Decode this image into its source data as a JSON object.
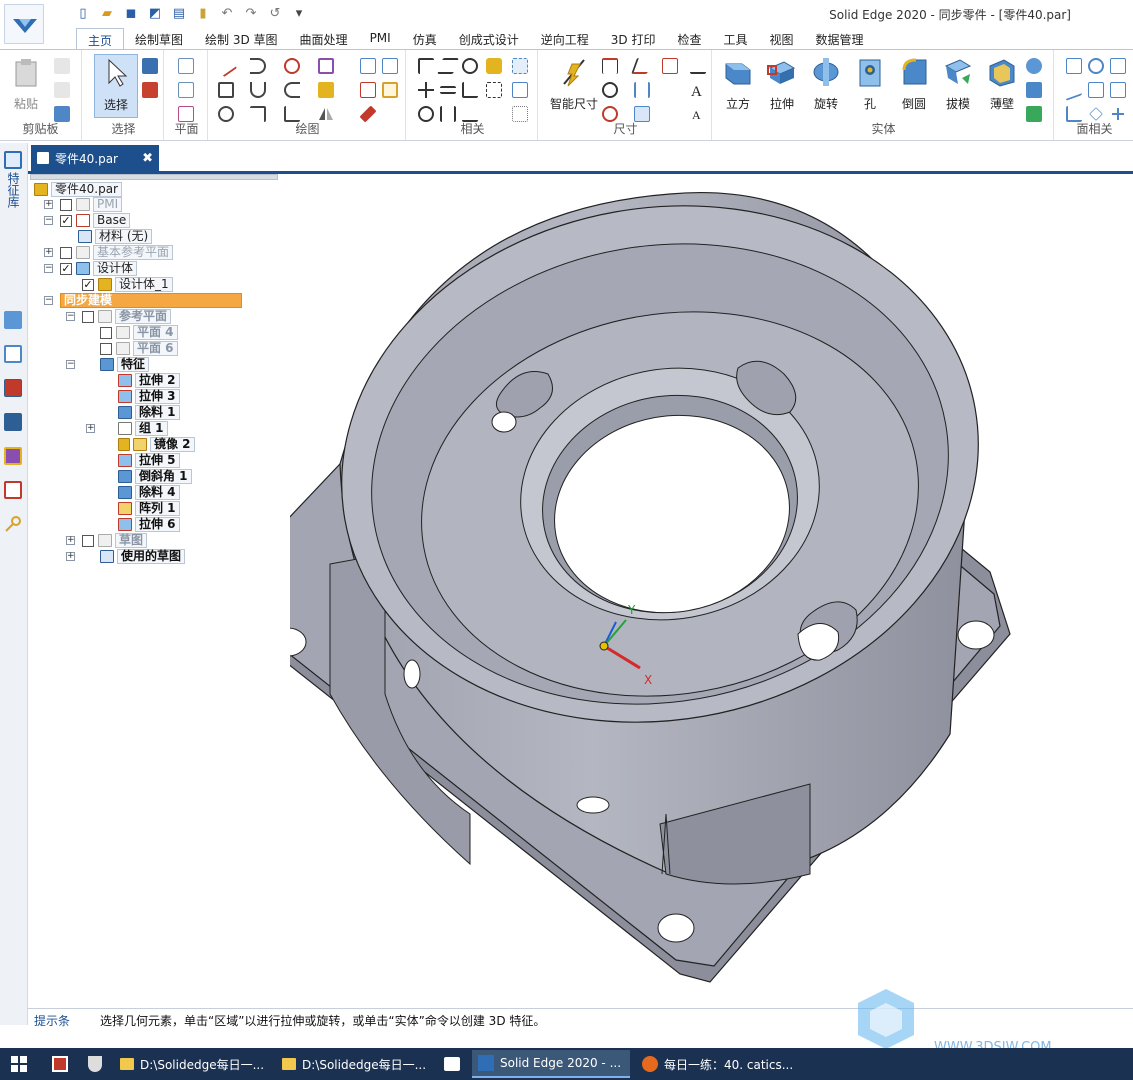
{
  "window": {
    "title": "Solid Edge 2020 - 同步零件 - [零件40.par]"
  },
  "quick_access": [
    "new-icon",
    "open-icon",
    "save-icon",
    "undo-icon",
    "redo-icon"
  ],
  "menu_tabs": [
    "主页",
    "绘制草图",
    "绘制 3D 草图",
    "曲面处理",
    "PMI",
    "仿真",
    "创成式设计",
    "逆向工程",
    "3D 打印",
    "检查",
    "工具",
    "视图",
    "数据管理"
  ],
  "ribbon": {
    "clipboard": {
      "paste_label": "粘贴",
      "group_label": "剪贴板"
    },
    "select": {
      "select_label": "选择",
      "group_label": "选择"
    },
    "plane": {
      "group_label": "平面"
    },
    "draw": {
      "group_label": "绘图"
    },
    "relate": {
      "group_label": "相关"
    },
    "dimension": {
      "smart_dim_label": "智能尺寸",
      "group_label": "尺寸"
    },
    "solids": {
      "buttons": [
        "立方",
        "拉伸",
        "旋转",
        "孔",
        "倒圆",
        "拔模",
        "薄壁"
      ],
      "group_label": "实体"
    },
    "face": {
      "group_label": "面相关"
    }
  },
  "left_toolbar": {
    "tab_label": "特征库"
  },
  "doc_tab": {
    "name": "零件40.par",
    "close": "✖"
  },
  "tree": {
    "root": "零件40.par",
    "pmi": "PMI",
    "base": "Base",
    "material": "材料 (无)",
    "base_ref_planes": "基本参考平面",
    "design_body": "设计体",
    "design_body_1": "设计体_1",
    "sync_modeling": "同步建模",
    "ref_planes": "参考平面",
    "plane4": "平面 4",
    "plane6": "平面 6",
    "features": "特征",
    "feature_items": [
      "拉伸 2",
      "拉伸 3",
      "除料 1",
      "组 1",
      "镜像 2",
      "拉伸 5",
      "倒斜角 1",
      "除料 4",
      "阵列 1",
      "拉伸 6"
    ],
    "sketches": "草图",
    "used_sketches": "使用的草图"
  },
  "triad": {
    "x": "X",
    "y": "Y"
  },
  "status": {
    "prompt_label": "提示条",
    "prompt_text": "选择几何元素，单击“区域”以进行拉伸或旋转，或单击“实体”命令以创建 3D 特征。"
  },
  "watermark": {
    "text": "WWW.3DSJW.COM"
  },
  "taskbar": {
    "items": [
      "D:\\Solidedge每日一...",
      "D:\\Solidedge每日一...",
      "Solid Edge 2020 - ...",
      "每日一练：40. catics..."
    ]
  },
  "colors": {
    "accent": "#1c4f8c",
    "model_gray": "#a9acb8",
    "highlight": "#f4a742"
  }
}
